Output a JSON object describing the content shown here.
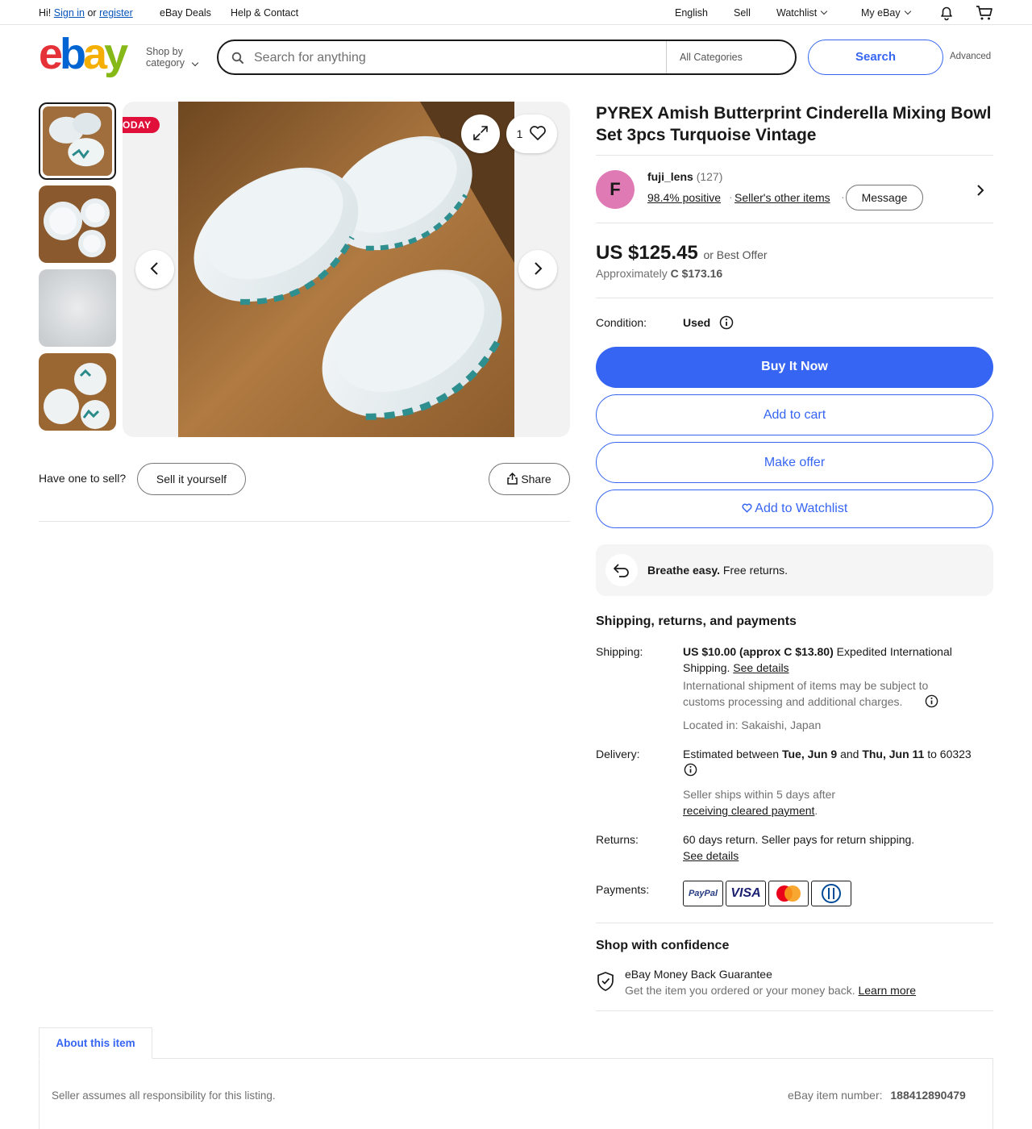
{
  "topbar": {
    "greeting": "Hi!",
    "sign_in": "Sign in",
    "or": "or",
    "register": "register",
    "deals": "eBay Deals",
    "help": "Help & Contact",
    "language": "English",
    "sell": "Sell",
    "watchlist": "Watchlist",
    "my_ebay": "My eBay"
  },
  "header": {
    "logo": {
      "e": "e",
      "b": "b",
      "a": "a",
      "y": "y"
    },
    "shop_by_1": "Shop by",
    "shop_by_2": "category",
    "search_placeholder": "Search for anything",
    "category": "All Categories",
    "search_button": "Search",
    "advanced": "Advanced"
  },
  "gallery": {
    "badge": "ODAY",
    "watch_count": "1"
  },
  "sell_bar": {
    "question": "Have one to sell?",
    "sell_button": "Sell it yourself",
    "share_button": "Share"
  },
  "item": {
    "title": "PYREX Amish Butterprint Cinderella Mixing Bowl Set 3pcs Turquoise Vintage",
    "seller": {
      "initial": "F",
      "name": "fuji_lens",
      "count": "(127)",
      "positive": "98.4% positive",
      "other_items": "Seller's other items",
      "message": "Message"
    },
    "price": "US $125.45",
    "best_offer": "or Best Offer",
    "approx_label": "Approximately",
    "approx_value": "C $173.16",
    "condition_label": "Condition:",
    "condition_value": "Used",
    "buy_now": "Buy It Now",
    "add_cart": "Add to cart",
    "make_offer": "Make offer",
    "add_watch": "Add to Watchlist",
    "returns_bold": "Breathe easy.",
    "returns_text": "Free returns."
  },
  "shipping": {
    "heading": "Shipping, returns, and payments",
    "shipping_label": "Shipping:",
    "shipping_bold": "US $10.00 (approx C $13.80)",
    "shipping_text": "Expedited International Shipping.",
    "see_details": "See details",
    "intl_note": "International shipment of items may be subject to customs processing and additional charges.",
    "located": "Located in: Sakaishi, Japan",
    "delivery_label": "Delivery:",
    "delivery_pre": "Estimated between",
    "delivery_d1": "Tue, Jun 9",
    "delivery_and": "and",
    "delivery_d2": "Thu, Jun 11",
    "delivery_post": "to 60323",
    "ships_within": "Seller ships within 5 days after",
    "cleared": "receiving cleared payment",
    "returns_label": "Returns:",
    "returns_text": "60 days return. Seller pays for return shipping.",
    "returns_details": "See details",
    "payments_label": "Payments:",
    "paypal": "PayPal",
    "visa": "VISA"
  },
  "confidence": {
    "heading": "Shop with confidence",
    "guarantee": "eBay Money Back Guarantee",
    "guarantee_text": "Get the item you ordered or your money back.",
    "learn_more": "Learn more"
  },
  "about": {
    "tab": "About this item",
    "seller_note": "Seller assumes all responsibility for this listing.",
    "item_number_label": "eBay item number:",
    "item_number": "188412890479"
  },
  "colors": {
    "accent": "#3665f3",
    "avatar": "#e07ab4",
    "badge": "#e0103a"
  }
}
